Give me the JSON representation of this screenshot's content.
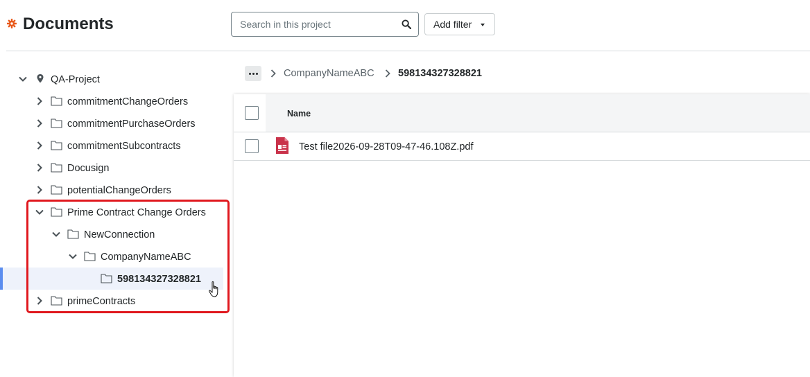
{
  "header": {
    "title": "Documents",
    "search": {
      "placeholder": "Search in this project",
      "value": ""
    },
    "filter_label": "Add filter"
  },
  "colors": {
    "accent": "#e8591a",
    "selection_bar": "#5b8def",
    "selection_bg": "#eef2fb",
    "highlight": "#e0181e",
    "pdf": "#c9324a"
  },
  "tree": {
    "root": {
      "label": "QA-Project",
      "icon": "location-pin-icon",
      "expanded": true
    },
    "items": [
      {
        "label": "commitmentChangeOrders",
        "level": 1,
        "state": "collapsed"
      },
      {
        "label": "commitmentPurchaseOrders",
        "level": 1,
        "state": "collapsed"
      },
      {
        "label": "commitmentSubcontracts",
        "level": 1,
        "state": "collapsed"
      },
      {
        "label": "Docusign",
        "level": 1,
        "state": "collapsed"
      },
      {
        "label": "potentialChangeOrders",
        "level": 1,
        "state": "collapsed"
      },
      {
        "label": "Prime Contract Change Orders",
        "level": 1,
        "state": "expanded"
      },
      {
        "label": "NewConnection",
        "level": 2,
        "state": "expanded"
      },
      {
        "label": "CompanyNameABC",
        "level": 3,
        "state": "expanded"
      },
      {
        "label": "598134327328821",
        "level": 4,
        "state": "leaf",
        "selected": true
      },
      {
        "label": "primeContracts",
        "level": 1,
        "state": "collapsed"
      }
    ]
  },
  "breadcrumb": {
    "more_icon": "ellipsis-icon",
    "parent": "CompanyNameABC",
    "current": "598134327328821"
  },
  "table": {
    "columns": [
      "Name"
    ],
    "rows": [
      {
        "name": "Test file2026-09-28T09-47-46.108Z.pdf",
        "icon": "pdf-file-icon"
      }
    ]
  }
}
